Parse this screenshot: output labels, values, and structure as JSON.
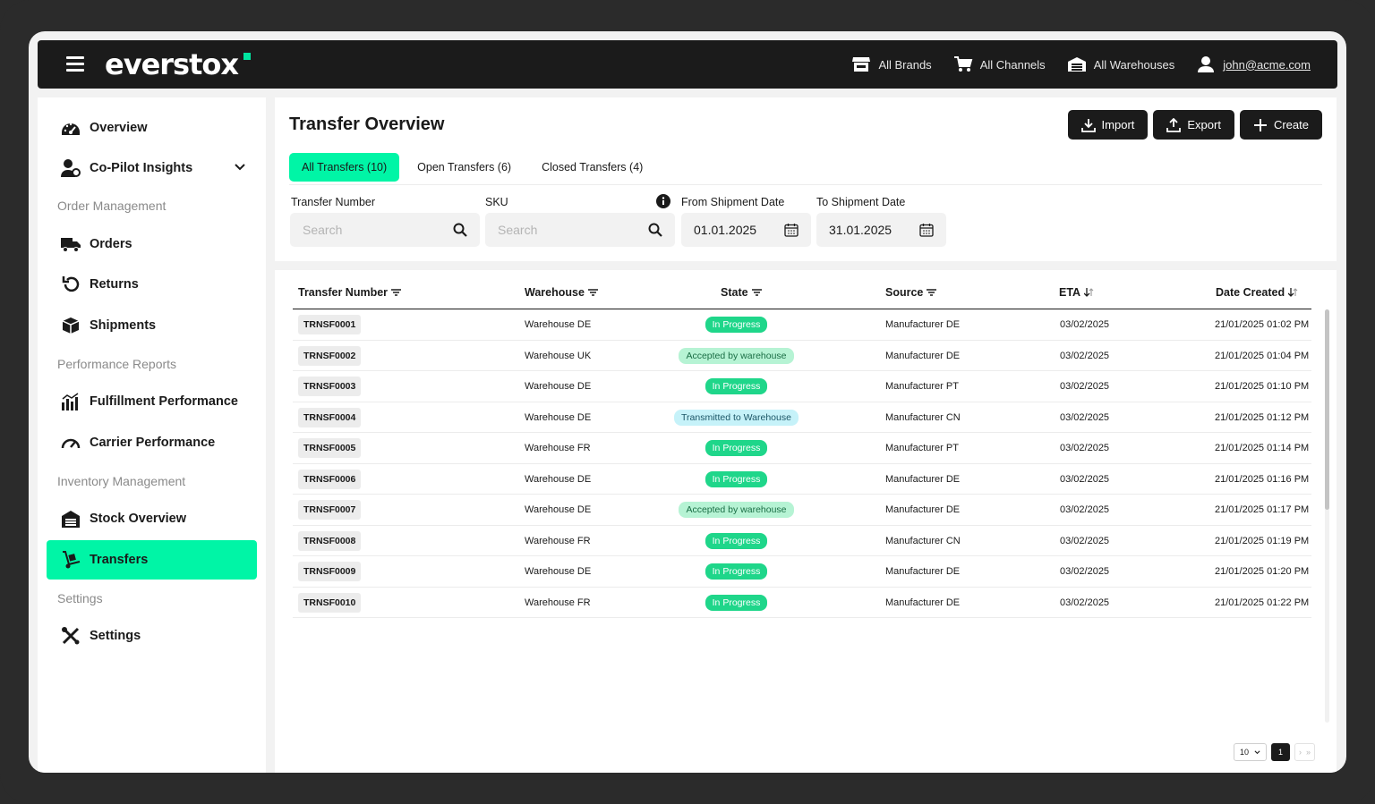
{
  "app": {
    "brand": "everstox"
  },
  "header": {
    "brands": "All Brands",
    "channels": "All Channels",
    "warehouses": "All Warehouses",
    "user_email": "john@acme.com"
  },
  "sidebar": {
    "overview": "Overview",
    "copilot": "Co-Pilot Insights",
    "section_order": "Order Management",
    "orders": "Orders",
    "returns": "Returns",
    "shipments": "Shipments",
    "section_performance": "Performance Reports",
    "fulfillment": "Fulfillment Performance",
    "carrier": "Carrier Performance",
    "section_inventory": "Inventory Management",
    "stock": "Stock Overview",
    "transfers": "Transfers",
    "section_settings": "Settings",
    "settings": "Settings"
  },
  "page": {
    "title": "Transfer Overview",
    "import": "Import",
    "export": "Export",
    "create": "Create",
    "tabs": [
      "All Transfers (10)",
      "Open Transfers (6)",
      "Closed Transfers (4)"
    ],
    "filters": {
      "transfer_number_label": "Transfer Number",
      "sku_label": "SKU",
      "search_placeholder": "Search",
      "from_label": "From Shipment Date",
      "to_label": "To Shipment Date",
      "from_value": "01.01.2025",
      "to_value": "31.01.2025"
    }
  },
  "table": {
    "headers": [
      "Transfer Number",
      "Warehouse",
      "State",
      "Source",
      "ETA",
      "Date Created"
    ],
    "rows": [
      {
        "id": "TRNSF0001",
        "warehouse": "Warehouse DE",
        "state": "In Progress",
        "source": "Manufacturer DE",
        "eta": "03/02/2025",
        "created": "21/01/2025 01:02 PM"
      },
      {
        "id": "TRNSF0002",
        "warehouse": "Warehouse UK",
        "state": "Accepted by warehouse",
        "source": "Manufacturer DE",
        "eta": "03/02/2025",
        "created": "21/01/2025 01:04 PM"
      },
      {
        "id": "TRNSF0003",
        "warehouse": "Warehouse DE",
        "state": "In Progress",
        "source": "Manufacturer PT",
        "eta": "03/02/2025",
        "created": "21/01/2025 01:10 PM"
      },
      {
        "id": "TRNSF0004",
        "warehouse": "Warehouse DE",
        "state": "Transmitted to Warehouse",
        "source": "Manufacturer CN",
        "eta": "03/02/2025",
        "created": "21/01/2025 01:12 PM"
      },
      {
        "id": "TRNSF0005",
        "warehouse": "Warehouse FR",
        "state": "In Progress",
        "source": "Manufacturer PT",
        "eta": "03/02/2025",
        "created": "21/01/2025 01:14 PM"
      },
      {
        "id": "TRNSF0006",
        "warehouse": "Warehouse DE",
        "state": "In Progress",
        "source": "Manufacturer DE",
        "eta": "03/02/2025",
        "created": "21/01/2025 01:16 PM"
      },
      {
        "id": "TRNSF0007",
        "warehouse": "Warehouse DE",
        "state": "Accepted by warehouse",
        "source": "Manufacturer DE",
        "eta": "03/02/2025",
        "created": "21/01/2025 01:17 PM"
      },
      {
        "id": "TRNSF0008",
        "warehouse": "Warehouse FR",
        "state": "In Progress",
        "source": "Manufacturer CN",
        "eta": "03/02/2025",
        "created": "21/01/2025 01:19 PM"
      },
      {
        "id": "TRNSF0009",
        "warehouse": "Warehouse DE",
        "state": "In Progress",
        "source": "Manufacturer DE",
        "eta": "03/02/2025",
        "created": "21/01/2025 01:20 PM"
      },
      {
        "id": "TRNSF0010",
        "warehouse": "Warehouse FR",
        "state": "In Progress",
        "source": "Manufacturer DE",
        "eta": "03/02/2025",
        "created": "21/01/2025 01:22 PM"
      }
    ],
    "state_colors": {
      "In Progress": "#1fd68a",
      "Accepted by warehouse": "#b6f3d4",
      "Transmitted to Warehouse": "#c6f2f9"
    }
  },
  "pagination": {
    "page_size": "10",
    "current_page": "1",
    "next": "›",
    "last": "»"
  },
  "colors": {
    "accent": "#00f5a6",
    "dark": "#1b1b1b"
  }
}
